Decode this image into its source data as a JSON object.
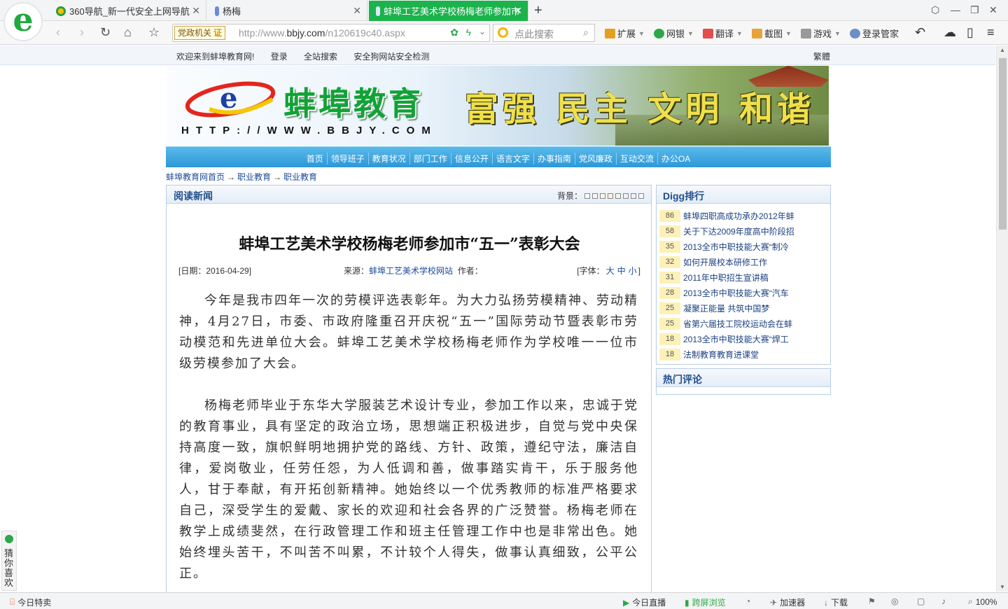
{
  "browser": {
    "tabs": [
      {
        "label": "360导航_新一代安全上网导航"
      },
      {
        "label": "杨梅"
      },
      {
        "label": "蚌埠工艺美术学校杨梅老师参加市"
      }
    ],
    "address": {
      "badge": "党政机关",
      "badge_mark": "证",
      "url_prefix": "http://www.",
      "url_domain": "bbjy.com",
      "url_suffix": "/n120619c40.aspx"
    },
    "search_placeholder": "点此搜索",
    "extensions": [
      "扩展",
      "网银",
      "翻译",
      "截图",
      "游戏",
      "登录管家"
    ]
  },
  "site_bar": {
    "welcome": "欢迎来到蚌埠教育网!",
    "login": "登录",
    "search": "全站搜索",
    "safety": "安全狗网站安全检测",
    "trad": "繁體"
  },
  "banner": {
    "title": "蚌埠教育",
    "url": "HTTP://WWW.BBJY.COM",
    "slogan": "富强 民主 文明 和谐"
  },
  "nav": [
    "首页",
    "领导班子",
    "教育状况",
    "部门工作",
    "信息公开",
    "语言文字",
    "办事指南",
    "党风廉政",
    "互动交流",
    "办公OA"
  ],
  "breadcrumb": {
    "home": "蚌埠教育网首页",
    "sep": "→",
    "level1": "职业教育",
    "level2": "职业教育"
  },
  "main": {
    "header": "阅读新闻",
    "bg_label": "背景：",
    "bg_colors": [
      "#ffffff",
      "#f5f5f5",
      "#fdf6e3",
      "#fef0e8",
      "#eef8e8",
      "#e8f4fc",
      "#f0eefc",
      "#f7f7f7"
    ],
    "title": "蚌埠工艺美术学校杨梅老师参加市“五一”表彰大会",
    "date": "[日期：2016-04-29]",
    "source_label": "来源：",
    "source": "蚌埠工艺美术学校网站",
    "author_label": "作者：",
    "font_open": "[字体：",
    "font_large": "大",
    "font_mid": "中",
    "font_small": "小",
    "font_close": "]",
    "paragraphs": [
      "今年是我市四年一次的劳模评选表彰年。为大力弘扬劳模精神、劳动精神，4月27日，市委、市政府隆重召开庆祝“五一”国际劳动节暨表彰市劳动模范和先进单位大会。蚌埠工艺美术学校杨梅老师作为学校唯一一位市级劳模参加了大会。",
      "杨梅老师毕业于东华大学服装艺术设计专业，参加工作以来，忠诚于党的教育事业，具有坚定的政治立场，思想端正积极进步，自觉与党中央保持高度一致，旗帜鲜明地拥护党的路线、方针、政策，遵纪守法，廉洁自律，爱岗敬业，任劳任怨，为人低调和善，做事踏实肯干，乐于服务他人，甘于奉献，有开拓创新精神。她始终以一个优秀教师的标准严格要求自己，深受学生的爱戴、家长的欢迎和社会各界的广泛赞誉。杨梅老师在教学上成绩斐然，在行政管理工作和班主任管理工作中也是非常出色。她始终埋头苦干，不叫苦不叫累，不计较个人得失，做事认真细致，公平公正。"
    ]
  },
  "digg": {
    "header": "Digg排行",
    "items": [
      {
        "n": "86",
        "t": "蚌埠四职高成功承办2012年蚌"
      },
      {
        "n": "58",
        "t": "关于下达2009年度高中阶段招"
      },
      {
        "n": "35",
        "t": "2013全市中职技能大赛“制冷"
      },
      {
        "n": "32",
        "t": "如何开展校本研修工作"
      },
      {
        "n": "31",
        "t": "2011年中职招生宣讲稿"
      },
      {
        "n": "28",
        "t": "2013全市中职技能大赛“汽车"
      },
      {
        "n": "25",
        "t": "凝聚正能量 共筑中国梦"
      },
      {
        "n": "25",
        "t": "省第六届技工院校运动会在蚌"
      },
      {
        "n": "18",
        "t": "2013全市中职技能大赛“焊工"
      },
      {
        "n": "18",
        "t": "法制教育教育进课堂"
      }
    ]
  },
  "hot": {
    "header": "热门评论"
  },
  "guess": "猜你喜欢",
  "statusbar": {
    "left": "今日特卖",
    "live": "今日直播",
    "cross": "跨屏浏览",
    "speed": "加速器",
    "download": "下载",
    "zoom": "100%"
  }
}
